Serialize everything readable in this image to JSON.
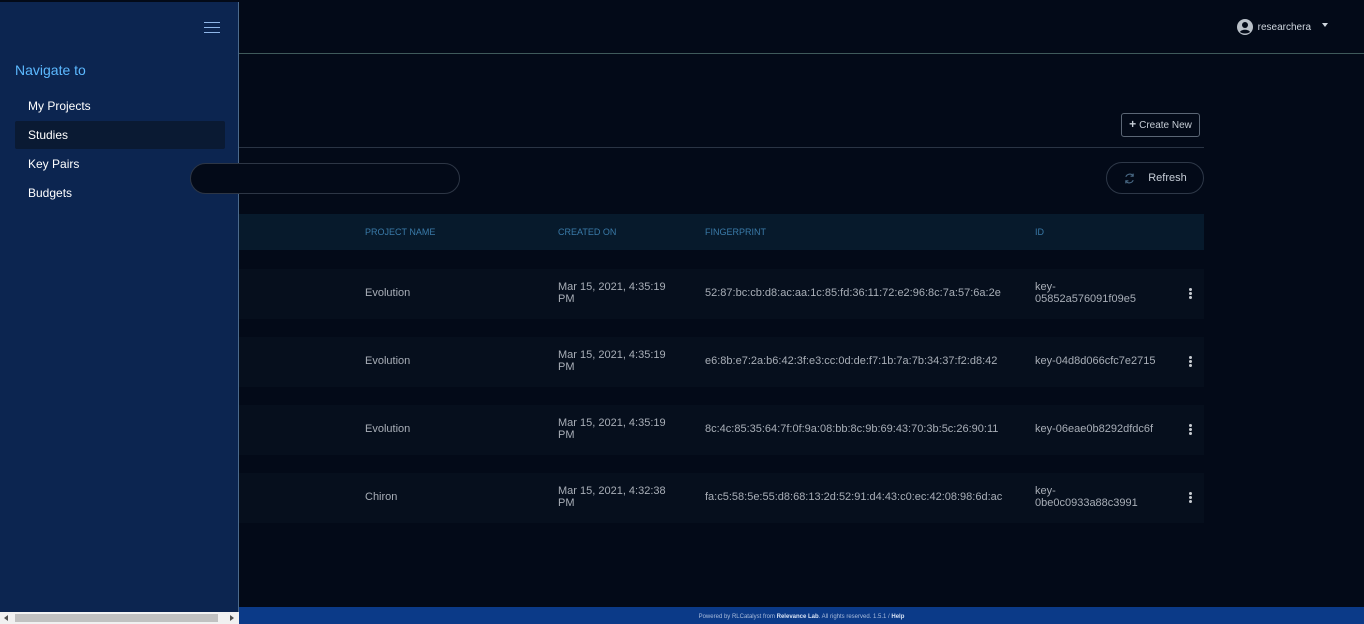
{
  "user": {
    "name": "researchera"
  },
  "sidebar": {
    "title": "Navigate to",
    "items": [
      {
        "label": "My Projects"
      },
      {
        "label": "Studies"
      },
      {
        "label": "Key Pairs"
      },
      {
        "label": "Budgets"
      }
    ]
  },
  "toolbar": {
    "create_label": "Create New",
    "refresh_label": "Refresh"
  },
  "table": {
    "headers": {
      "project_name": "PROJECT NAME",
      "created_on": "CREATED ON",
      "fingerprint": "FINGERPRINT",
      "id": "ID"
    },
    "rows": [
      {
        "project": "Evolution",
        "created_1": "Mar 15, 2021, 4:35:19",
        "created_2": "PM",
        "fingerprint": "52:87:bc:cb:d8:ac:aa:1c:85:fd:36:11:72:e2:96:8c:7a:57:6a:2e",
        "id_1": "key-",
        "id_2": "05852a576091f09e5"
      },
      {
        "project": "Evolution",
        "created_1": "Mar 15, 2021, 4:35:19",
        "created_2": "PM",
        "fingerprint": "e6:8b:e7:2a:b6:42:3f:e3:cc:0d:de:f7:1b:7a:7b:34:37:f2:d8:42",
        "id_1": "key-04d8d066cfc7e2715",
        "id_2": ""
      },
      {
        "project": "Evolution",
        "created_1": "Mar 15, 2021, 4:35:19",
        "created_2": "PM",
        "fingerprint": "8c:4c:85:35:64:7f:0f:9a:08:bb:8c:9b:69:43:70:3b:5c:26:90:11",
        "id_1": "key-06eae0b8292dfdc6f",
        "id_2": ""
      },
      {
        "project": "Chiron",
        "created_1": "Mar 15, 2021, 4:32:38",
        "created_2": "PM",
        "fingerprint": "fa:c5:58:5e:55:d8:68:13:2d:52:91:d4:43:c0:ec:42:08:98:6d:ac",
        "id_1": "key-",
        "id_2": "0be0c0933a88c3991"
      }
    ]
  },
  "footer": {
    "prefix": "Powered by RLCatalyst from",
    "company": "Relevance Lab",
    "suffix": ". All rights reserved. 1.5.1 /",
    "help": "Help"
  },
  "icons": {
    "user": "user-circle-icon",
    "menu": "hamburger-menu-icon",
    "refresh": "refresh-icon",
    "plus": "plus-icon",
    "row_menu": "kebab-menu-icon"
  }
}
